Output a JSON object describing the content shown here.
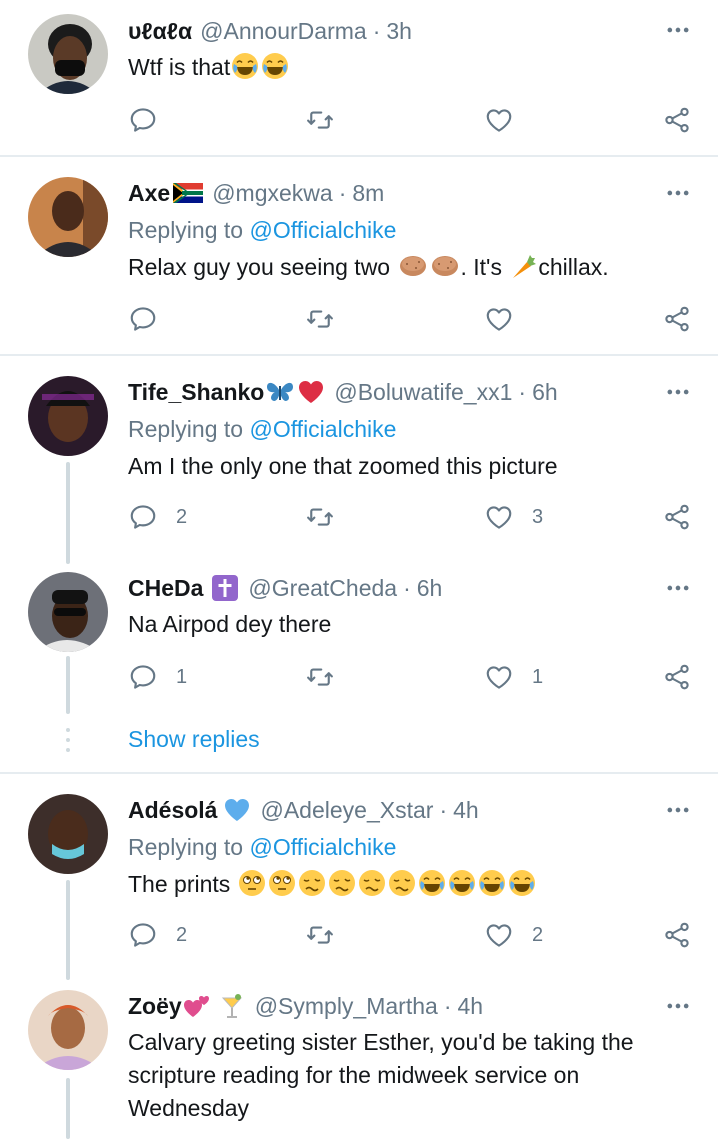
{
  "tweets": [
    {
      "name": "υℓαℓα",
      "handle": "@AnnourDarma",
      "time": "3h",
      "replying": "",
      "text": "Wtf is that",
      "reply_count": "",
      "like_count": ""
    },
    {
      "name": "Axe",
      "handle": "@mgxekwa",
      "time": "8m",
      "replying": "@Officialchike",
      "text_a": "Relax guy you seeing two ",
      "text_b": ". It's ",
      "text_c": "chillax.",
      "reply_count": "",
      "like_count": ""
    },
    {
      "name": "Tife_Shanko",
      "handle": "@Boluwatife_xx1",
      "time": "6h",
      "replying": "@Officialchike",
      "text": "Am I the only one that zoomed this picture",
      "reply_count": "2",
      "like_count": "3"
    },
    {
      "name": "CHeDa",
      "handle": "@GreatCheda",
      "time": "6h",
      "replying": "",
      "text": "Na Airpod dey there",
      "reply_count": "1",
      "like_count": "1"
    },
    {
      "name": "Adésolá",
      "handle": "@Adeleye_Xstar",
      "time": "4h",
      "replying": "@Officialchike",
      "text": "The prints ",
      "reply_count": "2",
      "like_count": "2"
    },
    {
      "name": "Zoëy",
      "handle": "@Symply_Martha",
      "time": "4h",
      "replying": "",
      "text_lines": [
        "Calvary greeting sister Esther, you'd be taking the",
        "scripture reading for the midweek service on",
        "Wednesday"
      ]
    }
  ],
  "labels": {
    "replying_to": "Replying to ",
    "show_replies": "Show replies",
    "dot": "·"
  },
  "icons": [
    "more-icon",
    "reply-icon",
    "retweet-icon",
    "like-icon",
    "share-icon"
  ],
  "colors": {
    "link": "#1b95e0",
    "secondary": "#657786",
    "divider": "#e6ecf0",
    "thread": "#cfd9de"
  }
}
